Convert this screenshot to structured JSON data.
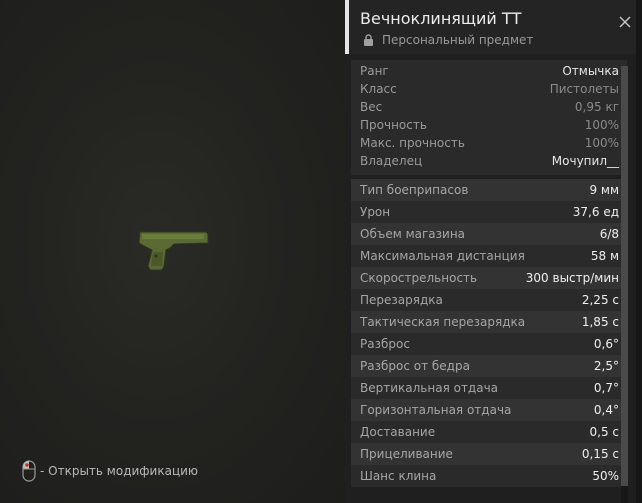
{
  "item": {
    "name": "Вечноклинящий ТТ",
    "subtitle": "Персональный предмет"
  },
  "hint": {
    "text": "- Открыть модификацию"
  },
  "info": [
    {
      "label": "Ранг",
      "value": "Отмычка",
      "dim": false
    },
    {
      "label": "Класс",
      "value": "Пистолеты",
      "dim": true
    },
    {
      "label": "Вес",
      "value": "0,95 кг",
      "dim": true
    },
    {
      "label": "Прочность",
      "value": "100%",
      "dim": true
    },
    {
      "label": "Макс. прочность",
      "value": "100%",
      "dim": true
    },
    {
      "label": "Владелец",
      "value": "Мочупил__",
      "dim": false
    }
  ],
  "stats": [
    {
      "label": "Тип боеприпасов",
      "value": "9 мм"
    },
    {
      "label": "Урон",
      "value": "37,6 ед"
    },
    {
      "label": "Объем магазина",
      "value": "6/8"
    },
    {
      "label": "Максимальная дистанция",
      "value": "58 м"
    },
    {
      "label": "Скорострельность",
      "value": "300 выстр/мин"
    },
    {
      "label": "Перезарядка",
      "value": "2,25 с"
    },
    {
      "label": "Тактическая перезарядка",
      "value": "1,85 с"
    },
    {
      "label": "Разброс",
      "value": "0,6°"
    },
    {
      "label": "Разброс от бедра",
      "value": "2,5°"
    },
    {
      "label": "Вертикальная отдача",
      "value": "0,7°"
    },
    {
      "label": "Горизонтальная отдача",
      "value": "0,4°"
    },
    {
      "label": "Доставание",
      "value": "0,5 с"
    },
    {
      "label": "Прицеливание",
      "value": "0,15 с"
    },
    {
      "label": "Шанс клина",
      "value": "50%"
    }
  ],
  "icons": {
    "lock": "lock-icon",
    "close": "close-icon",
    "mouse": "mouse-icon",
    "weapon": "pistol-image"
  }
}
